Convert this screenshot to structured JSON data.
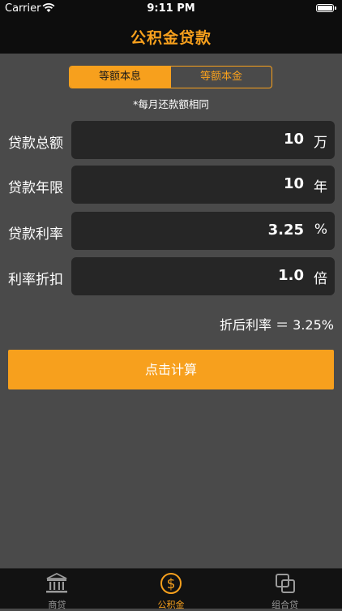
{
  "status_bar": {
    "carrier": "Carrier",
    "time": "9:11 PM"
  },
  "nav": {
    "title": "公积金贷款"
  },
  "segment": {
    "options": [
      "等额本息",
      "等额本金"
    ],
    "selected": "等额本息"
  },
  "note": "*每月还款额相同",
  "rows": [
    {
      "label": "贷款总额",
      "value": "10",
      "unit": "万"
    },
    {
      "label": "贷款年限",
      "value": "10",
      "unit": "年"
    },
    {
      "label": "贷款利率",
      "value": "3.25",
      "unit": "%"
    },
    {
      "label": "利率折扣",
      "value": "1.0",
      "unit": "倍"
    }
  ],
  "result": "折后利率 ＝ 3.25%",
  "calc_button": "点击计算",
  "tabs": [
    {
      "label": "商贷",
      "icon": "bank-icon",
      "active": false
    },
    {
      "label": "公积金",
      "icon": "dollar-circle-icon",
      "active": true
    },
    {
      "label": "组合贷",
      "icon": "overlap-squares-icon",
      "active": false
    }
  ],
  "colors": {
    "accent": "#f7a01d",
    "background": "#4a4a4a",
    "field": "#262626",
    "bar": "#0d0d0d"
  }
}
